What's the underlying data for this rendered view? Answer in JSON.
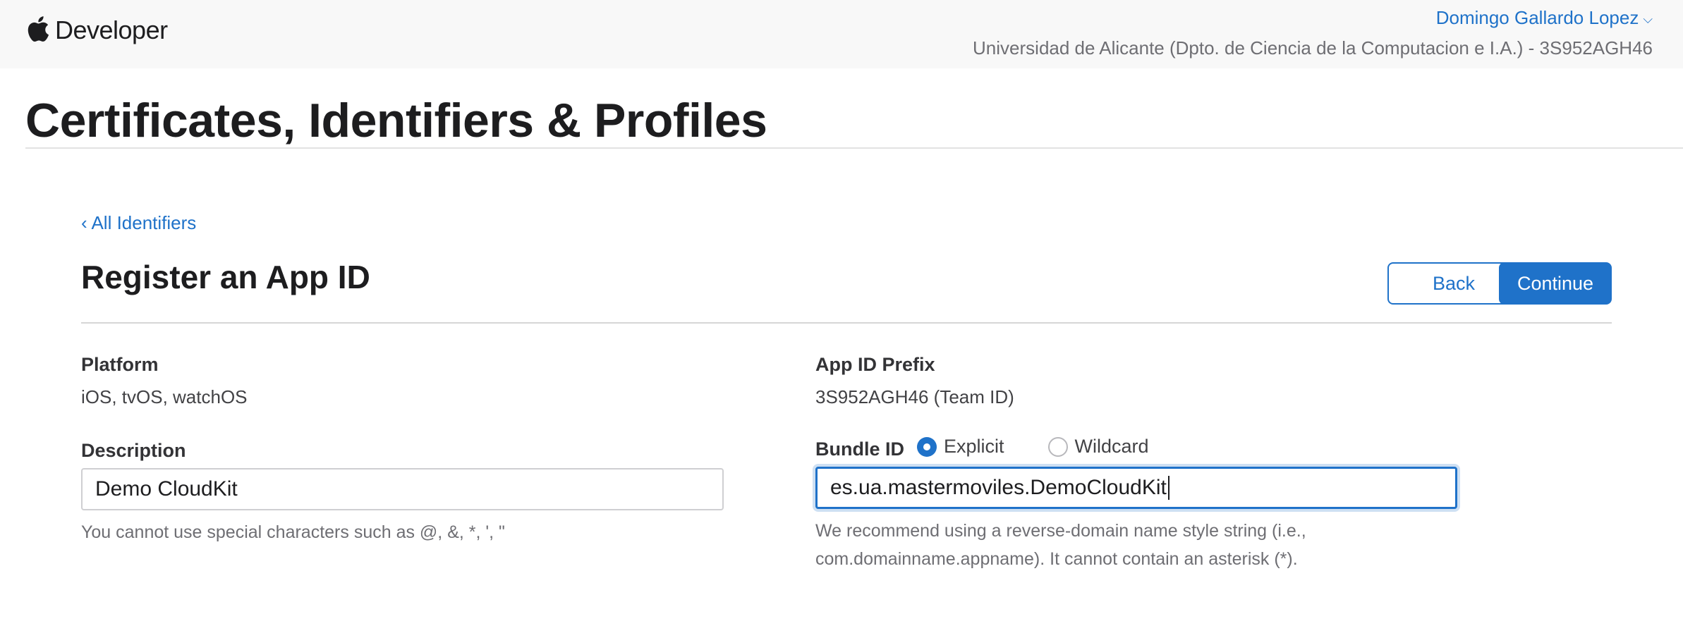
{
  "header": {
    "brand_text": "Developer",
    "logo_icon": "apple-logo-icon",
    "user_name": "Domingo Gallardo Lopez",
    "user_chevron": "⌵",
    "team_line": "Universidad de Alicante (Dpto. de Ciencia de la Computacion e I.A.) - 3S952AGH46"
  },
  "page": {
    "title": "Certificates, Identifiers & Profiles",
    "back_link": "‹ All Identifiers",
    "section_title": "Register an App ID"
  },
  "buttons": {
    "back": "Back",
    "continue": "Continue"
  },
  "form": {
    "platform_label": "Platform",
    "platform_value": "iOS, tvOS, watchOS",
    "prefix_label": "App ID Prefix",
    "prefix_value": "3S952AGH46 (Team ID)",
    "description_label": "Description",
    "description_value": "Demo CloudKit",
    "description_hint": "You cannot use special characters such as @, &, *, ', \"",
    "bundle_label": "Bundle ID",
    "bundle_options": [
      {
        "label": "Explicit",
        "selected": true
      },
      {
        "label": "Wildcard",
        "selected": false
      }
    ],
    "bundle_value": "es.ua.mastermoviles.DemoCloudKit",
    "bundle_hint_line1": "We recommend using a reverse-domain name style string (i.e.,",
    "bundle_hint_line2": "com.domainname.appname). It cannot contain an asterisk (*)."
  },
  "colors": {
    "accent": "#1f72c9",
    "header_bg": "#f8f8f8"
  }
}
